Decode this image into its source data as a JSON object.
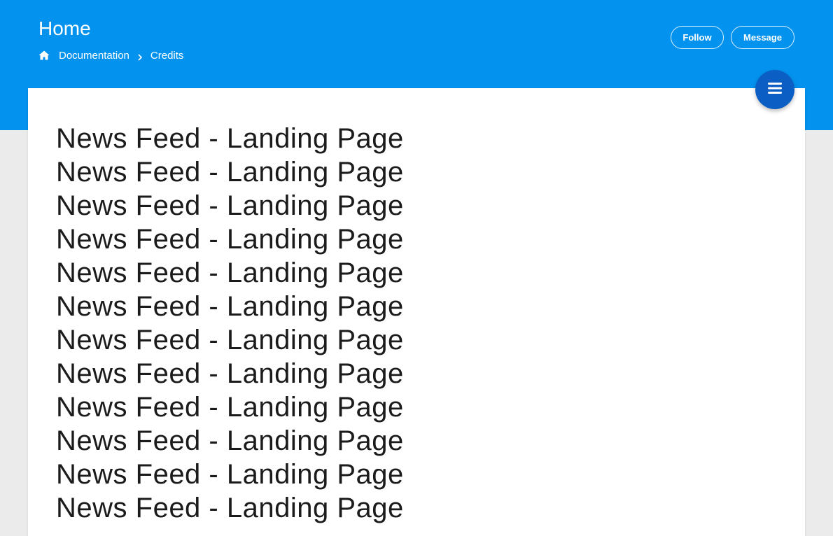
{
  "header": {
    "title": "Home",
    "breadcrumb": {
      "items": [
        "Documentation",
        "Credits"
      ]
    },
    "follow_label": "Follow",
    "message_label": "Message"
  },
  "icons": {
    "home": "home-icon",
    "separator": "chevron-right-icon",
    "menu": "hamburger-menu-icon"
  },
  "colors": {
    "header_blue": "#0392ee",
    "fab_blue": "#0b5fc4",
    "background": "#ebebeb",
    "card": "#ffffff"
  },
  "feed": {
    "items": [
      "News Feed - Landing Page",
      "News Feed - Landing Page",
      "News Feed - Landing Page",
      "News Feed - Landing Page",
      "News Feed - Landing Page",
      "News Feed - Landing Page",
      "News Feed - Landing Page",
      "News Feed - Landing Page",
      "News Feed - Landing Page",
      "News Feed - Landing Page",
      "News Feed - Landing Page",
      "News Feed - Landing Page"
    ]
  }
}
